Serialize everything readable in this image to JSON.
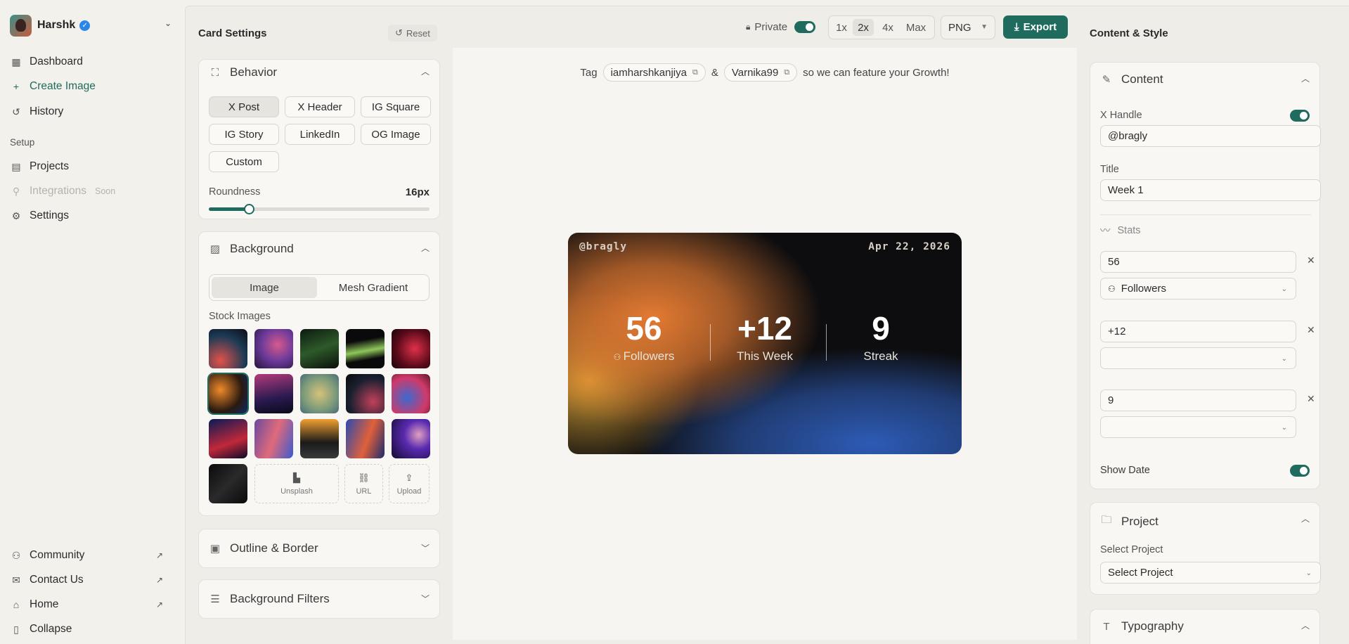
{
  "user": {
    "name": "Harshk"
  },
  "nav": {
    "dashboard": "Dashboard",
    "create_image": "Create Image",
    "history": "History",
    "setup_section": "Setup",
    "projects": "Projects",
    "integrations": "Integrations",
    "integrations_badge": "Soon",
    "settings": "Settings",
    "community": "Community",
    "contact_us": "Contact Us",
    "home": "Home",
    "collapse": "Collapse"
  },
  "card_settings": {
    "title": "Card Settings",
    "reset": "Reset",
    "behavior": {
      "title": "Behavior",
      "presets": [
        "X Post",
        "X Header",
        "IG Square",
        "IG Story",
        "LinkedIn",
        "OG Image",
        "Custom"
      ],
      "selected": "X Post",
      "roundness_label": "Roundness",
      "roundness_value": "16px",
      "roundness_fraction": 0.18
    },
    "background": {
      "title": "Background",
      "modes": [
        "Image",
        "Mesh Gradient"
      ],
      "selected_mode": "Image",
      "stock_label": "Stock Images",
      "actions": [
        "Unsplash",
        "URL",
        "Upload"
      ]
    },
    "outline_title": "Outline & Border",
    "filters_title": "Background Filters"
  },
  "toolbar": {
    "private_label": "Private",
    "scales": [
      "1x",
      "2x",
      "4x",
      "Max"
    ],
    "selected_scale": "2x",
    "format": "PNG",
    "export": "Export"
  },
  "tagline": {
    "prefix": "Tag",
    "handle1": "iamharshkanjiya",
    "amp": "&",
    "handle2": "Varnika99",
    "suffix": "so we can feature your Growth!"
  },
  "card": {
    "handle": "@bragly",
    "date": "Apr 22, 2026",
    "stats": [
      {
        "value": "56",
        "label": "Followers"
      },
      {
        "value": "+12",
        "label": "This Week"
      },
      {
        "value": "9",
        "label": "Streak"
      }
    ]
  },
  "content_style": {
    "title": "Content & Style",
    "content": {
      "title": "Content",
      "x_handle_label": "X Handle",
      "x_handle_value": "@bragly",
      "title_label": "Title",
      "title_value": "Week 1",
      "stats_label": "Stats",
      "stats": [
        {
          "value": "56",
          "type": "Followers"
        },
        {
          "value": "+12",
          "type": ""
        },
        {
          "value": "9",
          "type": ""
        }
      ],
      "show_date_label": "Show Date"
    },
    "project": {
      "title": "Project",
      "select_label": "Select Project",
      "select_value": "Select Project"
    },
    "typography_title": "Typography"
  },
  "colors": {
    "accent": "#1f6b5e",
    "background": "#f3f1ec"
  }
}
